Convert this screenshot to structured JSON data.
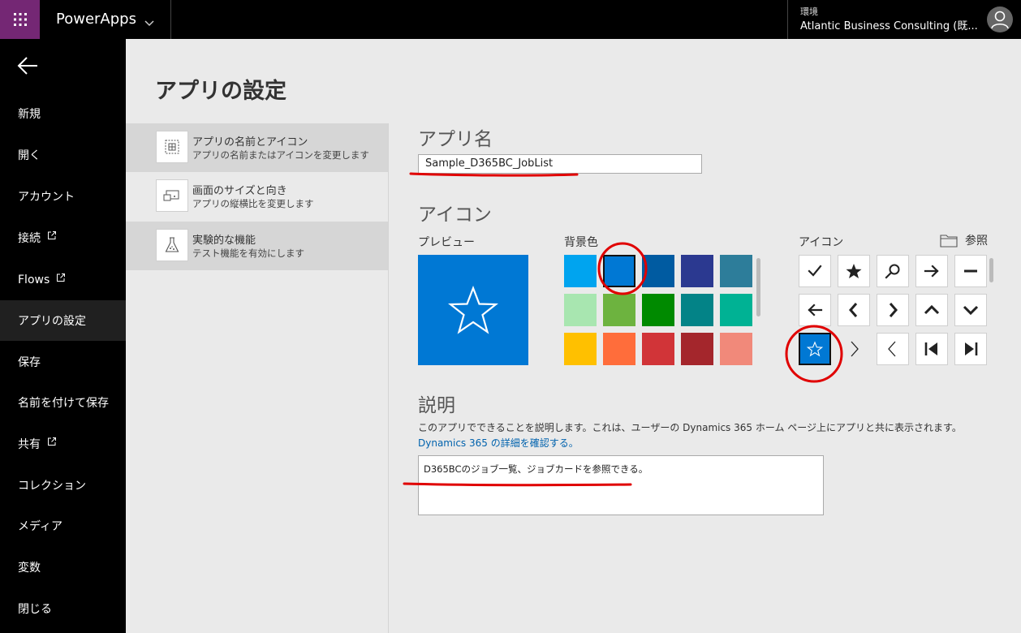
{
  "topbar": {
    "app_name": "PowerApps",
    "environment_label": "環境",
    "environment_name": "Atlantic Business Consulting (既..."
  },
  "nav": {
    "items": [
      {
        "label": "新規"
      },
      {
        "label": "開く"
      },
      {
        "label": "アカウント"
      },
      {
        "label": "接続"
      },
      {
        "label": "Flows"
      },
      {
        "label": "アプリの設定"
      },
      {
        "label": "保存"
      },
      {
        "label": "名前を付けて保存"
      },
      {
        "label": "共有"
      },
      {
        "label": "コレクション"
      },
      {
        "label": "メディア"
      },
      {
        "label": "変数"
      },
      {
        "label": "閉じる"
      }
    ],
    "active": "アプリの設定"
  },
  "page": {
    "title": "アプリの設定"
  },
  "settings_menu": [
    {
      "title": "アプリの名前とアイコン",
      "subtitle": "アプリの名前またはアイコンを変更します",
      "icon": "app-name-icon"
    },
    {
      "title": "画面のサイズと向き",
      "subtitle": "アプリの縦横比を変更します",
      "icon": "screen-size-icon"
    },
    {
      "title": "実験的な機能",
      "subtitle": "テスト機能を有効にします",
      "icon": "flask-icon"
    }
  ],
  "app_name_section": {
    "heading": "アプリ名",
    "value": "Sample_D365BC_JobList"
  },
  "icon_section": {
    "heading": "アイコン",
    "preview_label": "プレビュー",
    "background_label": "背景色",
    "icon_label": "アイコン",
    "browse_label": "参照",
    "preview_color": "#0078d4",
    "selected_color": "#0078d4",
    "selected_icon": "star-outline-icon",
    "colors": [
      "#00a4ef",
      "#0078d4",
      "#005ba1",
      "#2b3990",
      "#2d7d9a",
      "#a8e6b0",
      "#6db33f",
      "#008a00",
      "#038387",
      "#00b294",
      "#ffc000",
      "#ff6d3b",
      "#d13438",
      "#a4262c",
      "#f1897a"
    ],
    "icons": [
      "check-icon",
      "star-icon",
      "search-icon",
      "arrow-right-icon",
      "minus-icon",
      "arrow-left-icon",
      "chevron-left-icon",
      "chevron-right-icon",
      "chevron-up-icon",
      "chevron-down-icon",
      "star-outline-icon",
      "chevron-right-thin-icon",
      "chevron-left-thin-icon",
      "skip-first-icon",
      "skip-last-icon"
    ]
  },
  "description_section": {
    "heading": "説明",
    "text": "このアプリでできることを説明します。これは、ユーザーの Dynamics 365 ホーム ページ上にアプリと共に表示されます。",
    "link": "Dynamics 365 の詳細を確認する。",
    "value": "D365BCのジョブ一覧、ジョブカードを参照できる。"
  },
  "annotations": {
    "color": "#e00000"
  }
}
